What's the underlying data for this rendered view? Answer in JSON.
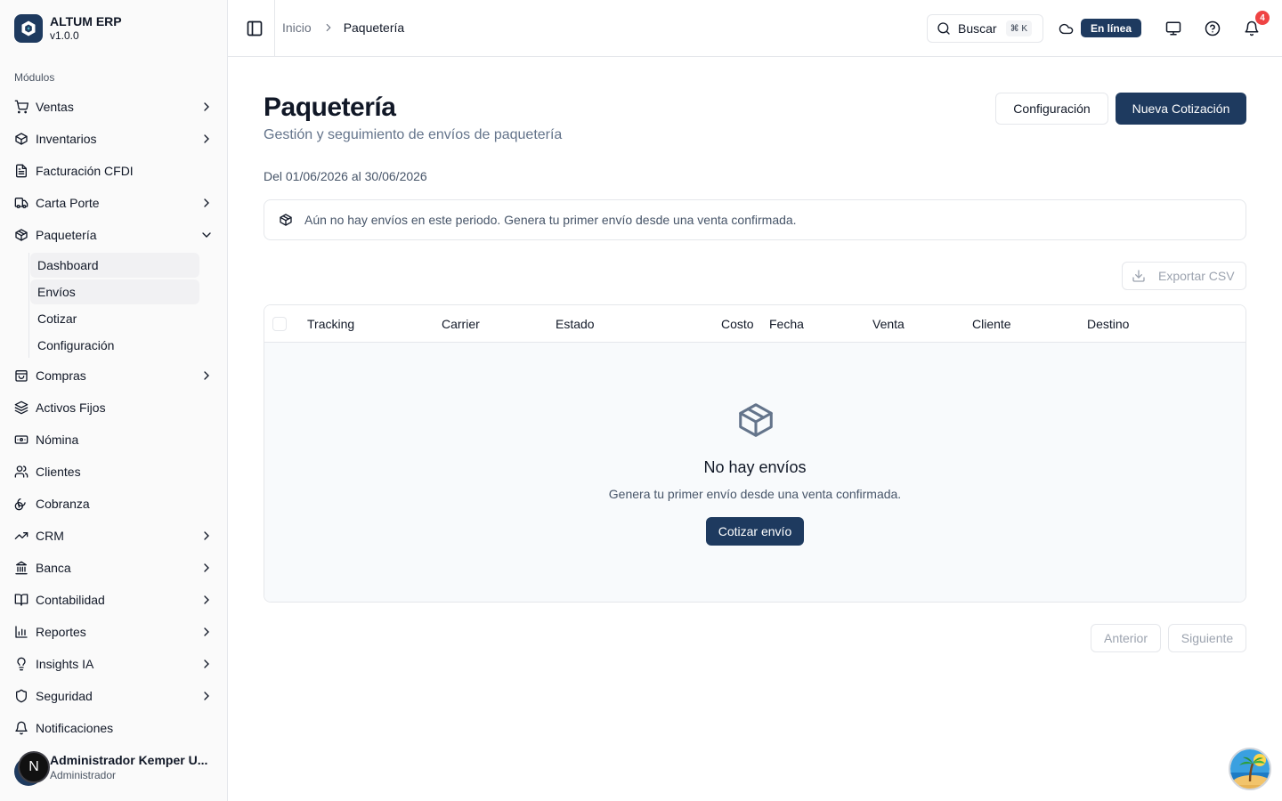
{
  "app": {
    "name": "ALTUM ERP",
    "version": "v1.0.0"
  },
  "sidebar": {
    "section_label": "Módulos",
    "items": [
      {
        "label": "Ventas",
        "icon": "cart-icon",
        "chevron": "right"
      },
      {
        "label": "Inventarios",
        "icon": "package-icon",
        "chevron": "right"
      },
      {
        "label": "Facturación CFDI",
        "icon": "file-text-icon",
        "chevron": ""
      },
      {
        "label": "Carta Porte",
        "icon": "truck-icon",
        "chevron": "right"
      },
      {
        "label": "Paquetería",
        "icon": "package-icon",
        "chevron": "down"
      },
      {
        "label": "Compras",
        "icon": "shopping-bag-icon",
        "chevron": "right"
      },
      {
        "label": "Activos Fijos",
        "icon": "layers-icon",
        "chevron": ""
      },
      {
        "label": "Nómina",
        "icon": "banknote-icon",
        "chevron": ""
      },
      {
        "label": "Clientes",
        "icon": "users-icon",
        "chevron": ""
      },
      {
        "label": "Cobranza",
        "icon": "coins-icon",
        "chevron": ""
      },
      {
        "label": "CRM",
        "icon": "trending-up-icon",
        "chevron": "right"
      },
      {
        "label": "Banca",
        "icon": "bank-icon",
        "chevron": "right"
      },
      {
        "label": "Contabilidad",
        "icon": "book-open-icon",
        "chevron": "right"
      },
      {
        "label": "Reportes",
        "icon": "bar-chart-icon",
        "chevron": "right"
      },
      {
        "label": "Insights IA",
        "icon": "lightbulb-icon",
        "chevron": "right"
      },
      {
        "label": "Seguridad",
        "icon": "shield-icon",
        "chevron": "right"
      },
      {
        "label": "Notificaciones",
        "icon": "bell-icon",
        "chevron": ""
      }
    ],
    "subitems": [
      {
        "label": "Dashboard",
        "active": true
      },
      {
        "label": "Envíos",
        "active": true
      },
      {
        "label": "Cotizar",
        "active": false
      },
      {
        "label": "Configuración",
        "active": false
      }
    ],
    "user": {
      "initial": "N",
      "name": "Administrador Kemper U...",
      "role": "Administrador"
    }
  },
  "header": {
    "breadcrumb_home": "Inicio",
    "breadcrumb_current": "Paquetería",
    "search_label": "Buscar",
    "search_shortcut": "⌘ K",
    "status": "En línea",
    "notification_count": "4"
  },
  "main": {
    "title": "Paquetería",
    "subtitle": "Gestión y seguimiento de envíos de paquetería",
    "config_button": "Configuración",
    "new_quote_button": "Nueva Cotización",
    "period": "Del 01/06/2026 al 30/06/2026",
    "alert": "Aún no hay envíos en este periodo. Genera tu primer envío desde una venta confirmada.",
    "export_button": "Exportar CSV",
    "table": {
      "columns": [
        "Tracking",
        "Carrier",
        "Estado",
        "Costo",
        "Fecha",
        "Venta",
        "Cliente",
        "Destino"
      ]
    },
    "empty": {
      "title": "No hay envíos",
      "subtitle": "Genera tu primer envío desde una venta confirmada.",
      "button": "Cotizar envío"
    },
    "pagination": {
      "prev": "Anterior",
      "next": "Siguiente"
    }
  },
  "colors": {
    "primary": "#1e3a5f",
    "danger": "#ef4444",
    "border": "#e5e7eb",
    "muted": "#64748b"
  }
}
